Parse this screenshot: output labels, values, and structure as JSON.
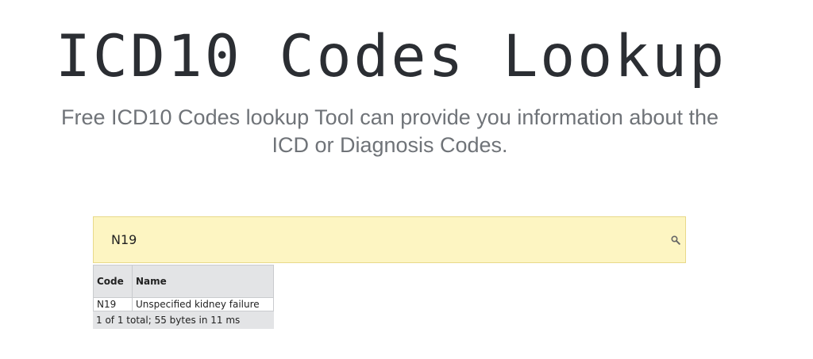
{
  "header": {
    "title": "ICD10 Codes Lookup",
    "subtitle": "Free ICD10 Codes lookup Tool can provide you information about the ICD or Diagnosis Codes."
  },
  "search": {
    "value": "N19",
    "placeholder": "",
    "icon": "search-icon"
  },
  "results": {
    "columns": [
      "Code",
      "Name"
    ],
    "rows": [
      {
        "code": "N19",
        "name": "Unspecified kidney failure"
      }
    ],
    "footer": "1 of 1 total; 55  bytes in 11 ms"
  },
  "colors": {
    "search_background": "#fdf5c2",
    "title_color": "#2b2e33",
    "subtitle_color": "#6f7378",
    "table_header_background": "#e3e4e6"
  }
}
